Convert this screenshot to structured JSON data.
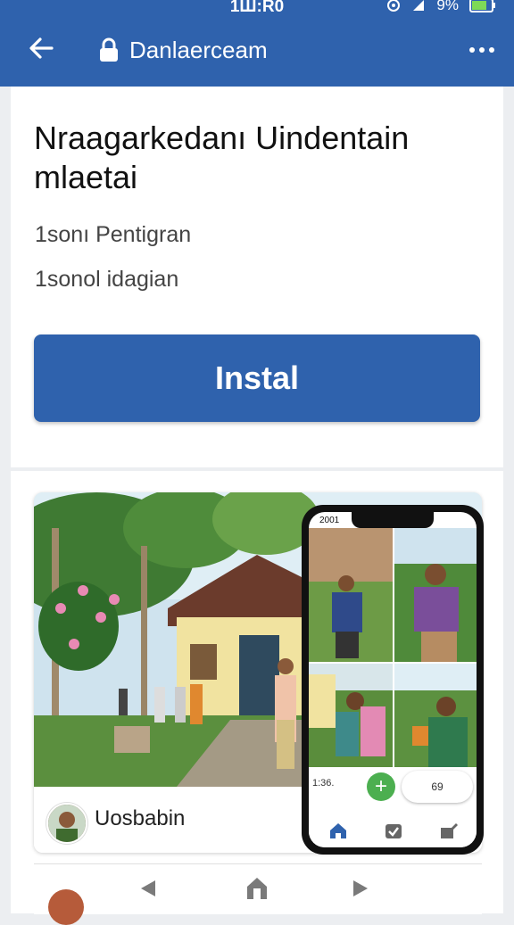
{
  "status_bar": {
    "time": "1Ш:R0",
    "battery": "9%"
  },
  "app_bar": {
    "title": "Danlaerceam"
  },
  "listing": {
    "title": "Nraagarkedanı Uindentain mlaetai",
    "meta1": "1sonı Pentigran",
    "meta2": "1sonol idagian",
    "install_label": "Instal"
  },
  "post": {
    "author": "Uosbabin",
    "phone": {
      "time": "2001",
      "left_chip": "1:36.",
      "right_chip": "69"
    }
  },
  "colors": {
    "primary": "#2f62ad",
    "fab": "#4caf50"
  }
}
